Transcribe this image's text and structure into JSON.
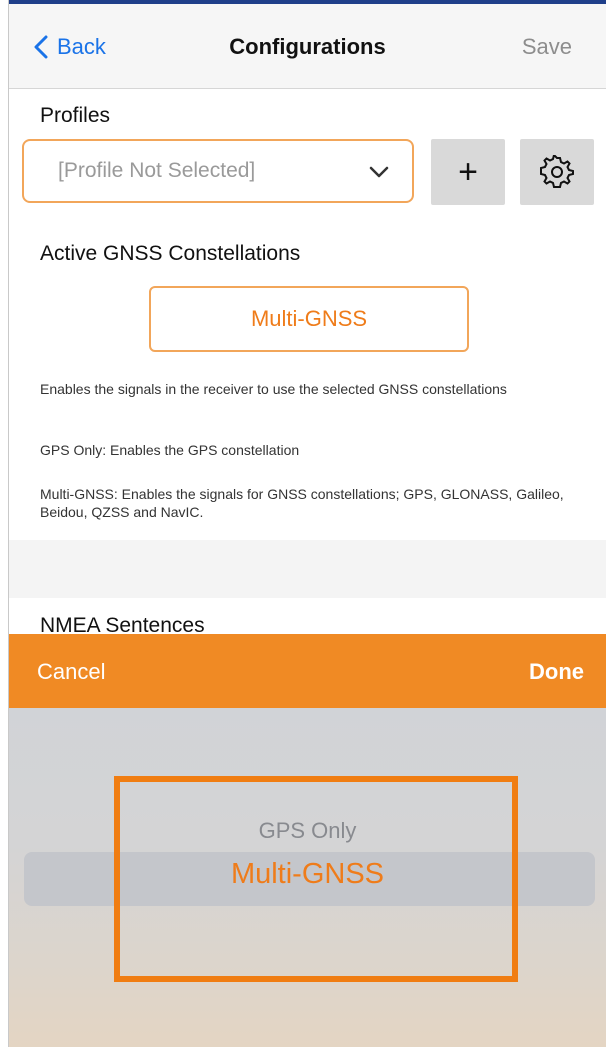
{
  "nav": {
    "back_label": "Back",
    "title": "Configurations",
    "save_label": "Save"
  },
  "profiles": {
    "label": "Profiles",
    "selected": "[Profile Not Selected]",
    "add_label": "+"
  },
  "gnss": {
    "label": "Active GNSS Constellations",
    "button_label": "Multi-GNSS",
    "descriptions": [
      "Enables the signals in the receiver to use the selected GNSS constellations",
      "GPS Only: Enables the GPS constellation",
      "Multi-GNSS: Enables the signals for GNSS constellations; GPS, GLONASS, Galileo, Beidou, QZSS and NavIC."
    ]
  },
  "nmea": {
    "label": "NMEA Sentences"
  },
  "picker": {
    "cancel_label": "Cancel",
    "done_label": "Done",
    "options": [
      "GPS Only",
      "Multi-GNSS"
    ],
    "selected": "Multi-GNSS"
  },
  "colors": {
    "accent": "#ef7c1a",
    "toolbar": "#f08a24",
    "link": "#1a73e8"
  }
}
